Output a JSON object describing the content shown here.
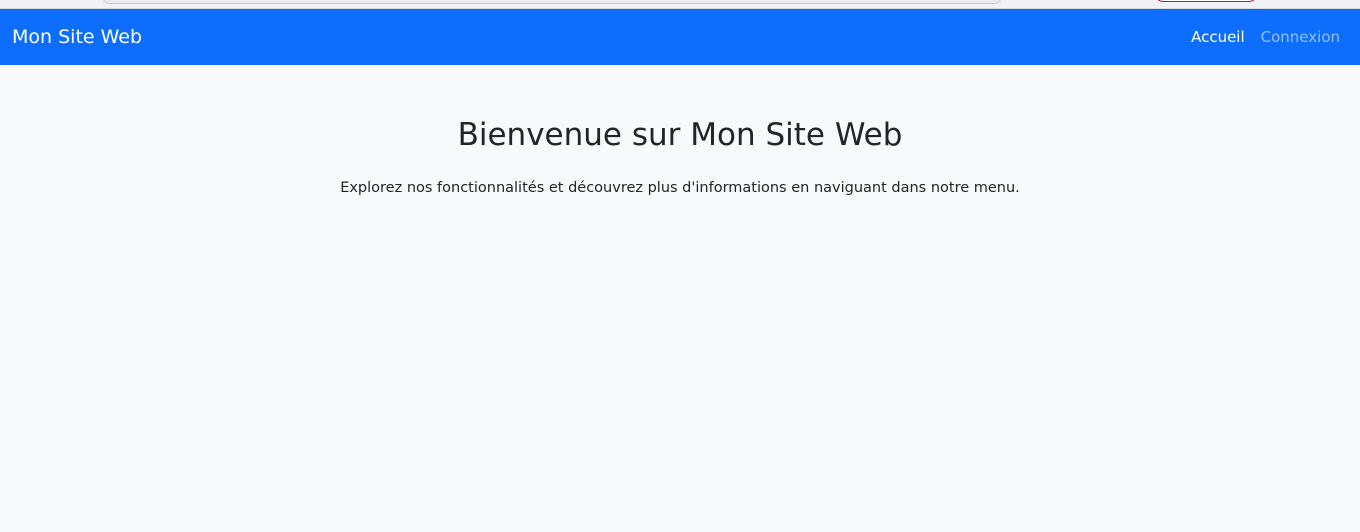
{
  "navbar": {
    "brand": "Mon Site Web",
    "links": [
      {
        "label": "Accueil"
      },
      {
        "label": "Connexion"
      }
    ]
  },
  "main": {
    "title": "Bienvenue sur Mon Site Web",
    "intro": "Explorez nos fonctionnalités et découvrez plus d'informations en naviguant dans notre menu."
  },
  "colors": {
    "navbar_bg": "#0d6efd",
    "page_bg": "#f8f9fa",
    "text": "#212529"
  }
}
